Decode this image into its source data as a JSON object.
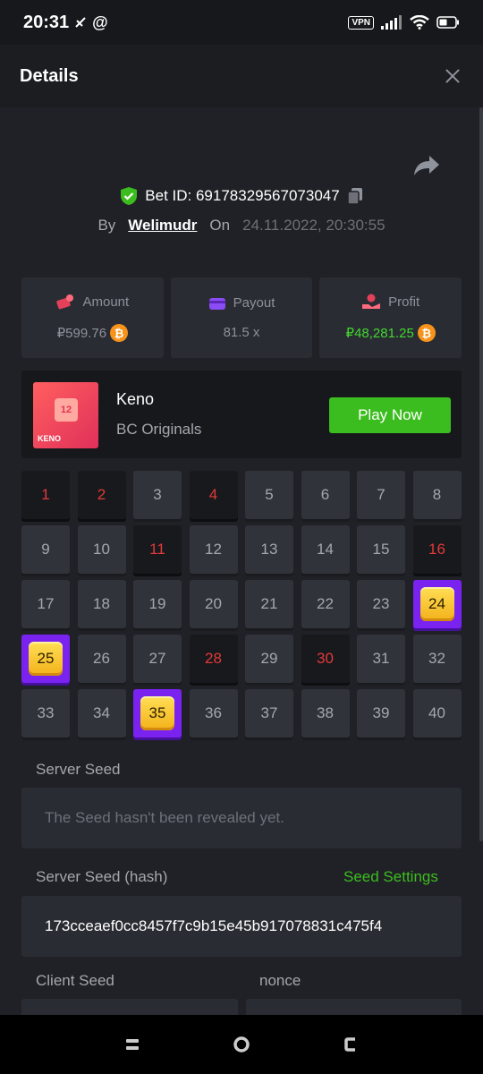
{
  "status": {
    "time": "20:31",
    "vpn": "VPN"
  },
  "header": {
    "title": "Details"
  },
  "bet": {
    "label": "Bet ID: 69178329567073047",
    "by_label": "By",
    "user": "Welimudr",
    "on_label": "On",
    "date": "24.11.2022, 20:30:55"
  },
  "stats": {
    "amount": {
      "label": "Amount",
      "value": "₽599.76"
    },
    "payout": {
      "label": "Payout",
      "value": "81.5 x"
    },
    "profit": {
      "label": "Profit",
      "value": "₽48,281.25"
    }
  },
  "game": {
    "name": "Keno",
    "provider": "BC Originals",
    "play_label": "Play Now",
    "thumb_number": "12",
    "thumb_text": "KENO"
  },
  "grid": {
    "cells": [
      {
        "n": "1",
        "s": "miss"
      },
      {
        "n": "2",
        "s": "miss"
      },
      {
        "n": "3",
        "s": ""
      },
      {
        "n": "4",
        "s": "miss"
      },
      {
        "n": "5",
        "s": ""
      },
      {
        "n": "6",
        "s": ""
      },
      {
        "n": "7",
        "s": ""
      },
      {
        "n": "8",
        "s": ""
      },
      {
        "n": "9",
        "s": ""
      },
      {
        "n": "10",
        "s": ""
      },
      {
        "n": "11",
        "s": "miss"
      },
      {
        "n": "12",
        "s": ""
      },
      {
        "n": "13",
        "s": ""
      },
      {
        "n": "14",
        "s": ""
      },
      {
        "n": "15",
        "s": ""
      },
      {
        "n": "16",
        "s": "miss"
      },
      {
        "n": "17",
        "s": ""
      },
      {
        "n": "18",
        "s": ""
      },
      {
        "n": "19",
        "s": ""
      },
      {
        "n": "20",
        "s": ""
      },
      {
        "n": "21",
        "s": ""
      },
      {
        "n": "22",
        "s": ""
      },
      {
        "n": "23",
        "s": ""
      },
      {
        "n": "24",
        "s": "hit"
      },
      {
        "n": "25",
        "s": "hit"
      },
      {
        "n": "26",
        "s": ""
      },
      {
        "n": "27",
        "s": ""
      },
      {
        "n": "28",
        "s": "miss"
      },
      {
        "n": "29",
        "s": ""
      },
      {
        "n": "30",
        "s": "miss"
      },
      {
        "n": "31",
        "s": ""
      },
      {
        "n": "32",
        "s": ""
      },
      {
        "n": "33",
        "s": ""
      },
      {
        "n": "34",
        "s": ""
      },
      {
        "n": "35",
        "s": "hit"
      },
      {
        "n": "36",
        "s": ""
      },
      {
        "n": "37",
        "s": ""
      },
      {
        "n": "38",
        "s": ""
      },
      {
        "n": "39",
        "s": ""
      },
      {
        "n": "40",
        "s": ""
      }
    ]
  },
  "seeds": {
    "server_seed_label": "Server Seed",
    "server_seed_value": "The Seed hasn't been revealed yet.",
    "server_hash_label": "Server Seed (hash)",
    "seed_settings": "Seed Settings",
    "server_hash_value": "173cceaef0cc8457f7c9b15e45b917078831c475f4",
    "client_seed_label": "Client Seed",
    "nonce_label": "nonce"
  },
  "colors": {
    "accent_green": "#3cbd1f",
    "miss_red": "#e1393a",
    "hit_purple": "#7a22f0",
    "btc_orange": "#f7931a"
  }
}
